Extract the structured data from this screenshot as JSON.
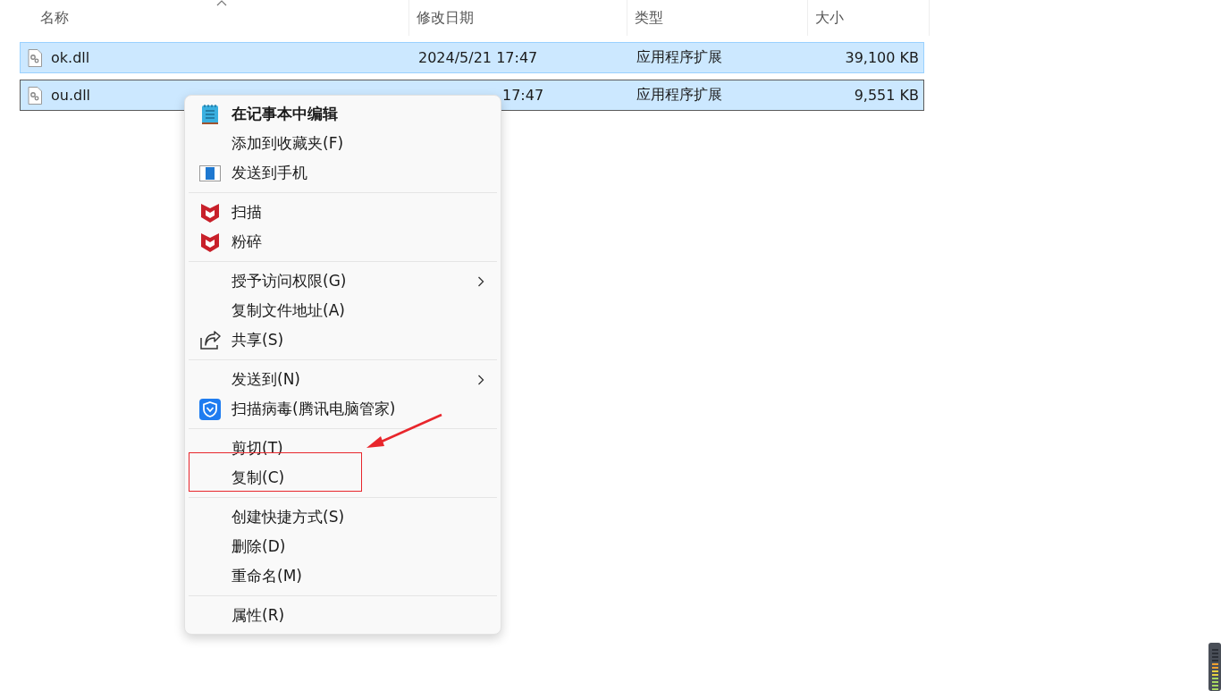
{
  "columns": [
    {
      "label": "名称",
      "sorted": true
    },
    {
      "label": "修改日期",
      "sorted": false
    },
    {
      "label": "类型",
      "sorted": false
    },
    {
      "label": "大小",
      "sorted": false
    }
  ],
  "files": [
    {
      "name": "ok.dll",
      "date": "2024/5/21 17:47",
      "date_covered": false,
      "type": "应用程序扩展",
      "size": "39,100 KB",
      "selected": true,
      "focused": false
    },
    {
      "name": "ou.dll",
      "date": "17:47",
      "date_covered": true,
      "type": "应用程序扩展",
      "size": "9,551 KB",
      "selected": true,
      "focused": true
    }
  ],
  "context_menu": {
    "groups": [
      [
        {
          "label": "在记事本中编辑",
          "kind": "notepad",
          "bold": true,
          "submenu": false
        },
        {
          "label": "添加到收藏夹(F)",
          "kind": "plain",
          "bold": false,
          "submenu": false
        },
        {
          "label": "发送到手机",
          "kind": "phone",
          "bold": false,
          "submenu": false
        }
      ],
      [
        {
          "label": "扫描",
          "kind": "shield",
          "bold": false,
          "submenu": false
        },
        {
          "label": "粉碎",
          "kind": "shield",
          "bold": false,
          "submenu": false
        }
      ],
      [
        {
          "label": "授予访问权限(G)",
          "kind": "plain",
          "bold": false,
          "submenu": true
        },
        {
          "label": "复制文件地址(A)",
          "kind": "plain",
          "bold": false,
          "submenu": false
        },
        {
          "label": "共享(S)",
          "kind": "share",
          "bold": false,
          "submenu": false
        }
      ],
      [
        {
          "label": "发送到(N)",
          "kind": "plain",
          "bold": false,
          "submenu": true
        },
        {
          "label": "扫描病毒(腾讯电脑管家)",
          "kind": "guard",
          "bold": false,
          "submenu": false
        }
      ],
      [
        {
          "label": "剪切(T)",
          "kind": "plain",
          "bold": false,
          "submenu": false
        },
        {
          "label": "复制(C)",
          "kind": "plain",
          "bold": false,
          "submenu": false
        }
      ],
      [
        {
          "label": "创建快捷方式(S)",
          "kind": "plain",
          "bold": false,
          "submenu": false
        },
        {
          "label": "删除(D)",
          "kind": "plain",
          "bold": false,
          "submenu": false
        },
        {
          "label": "重命名(M)",
          "kind": "plain",
          "bold": false,
          "submenu": false
        }
      ],
      [
        {
          "label": "属性(R)",
          "kind": "plain",
          "bold": false,
          "submenu": false
        }
      ]
    ]
  }
}
